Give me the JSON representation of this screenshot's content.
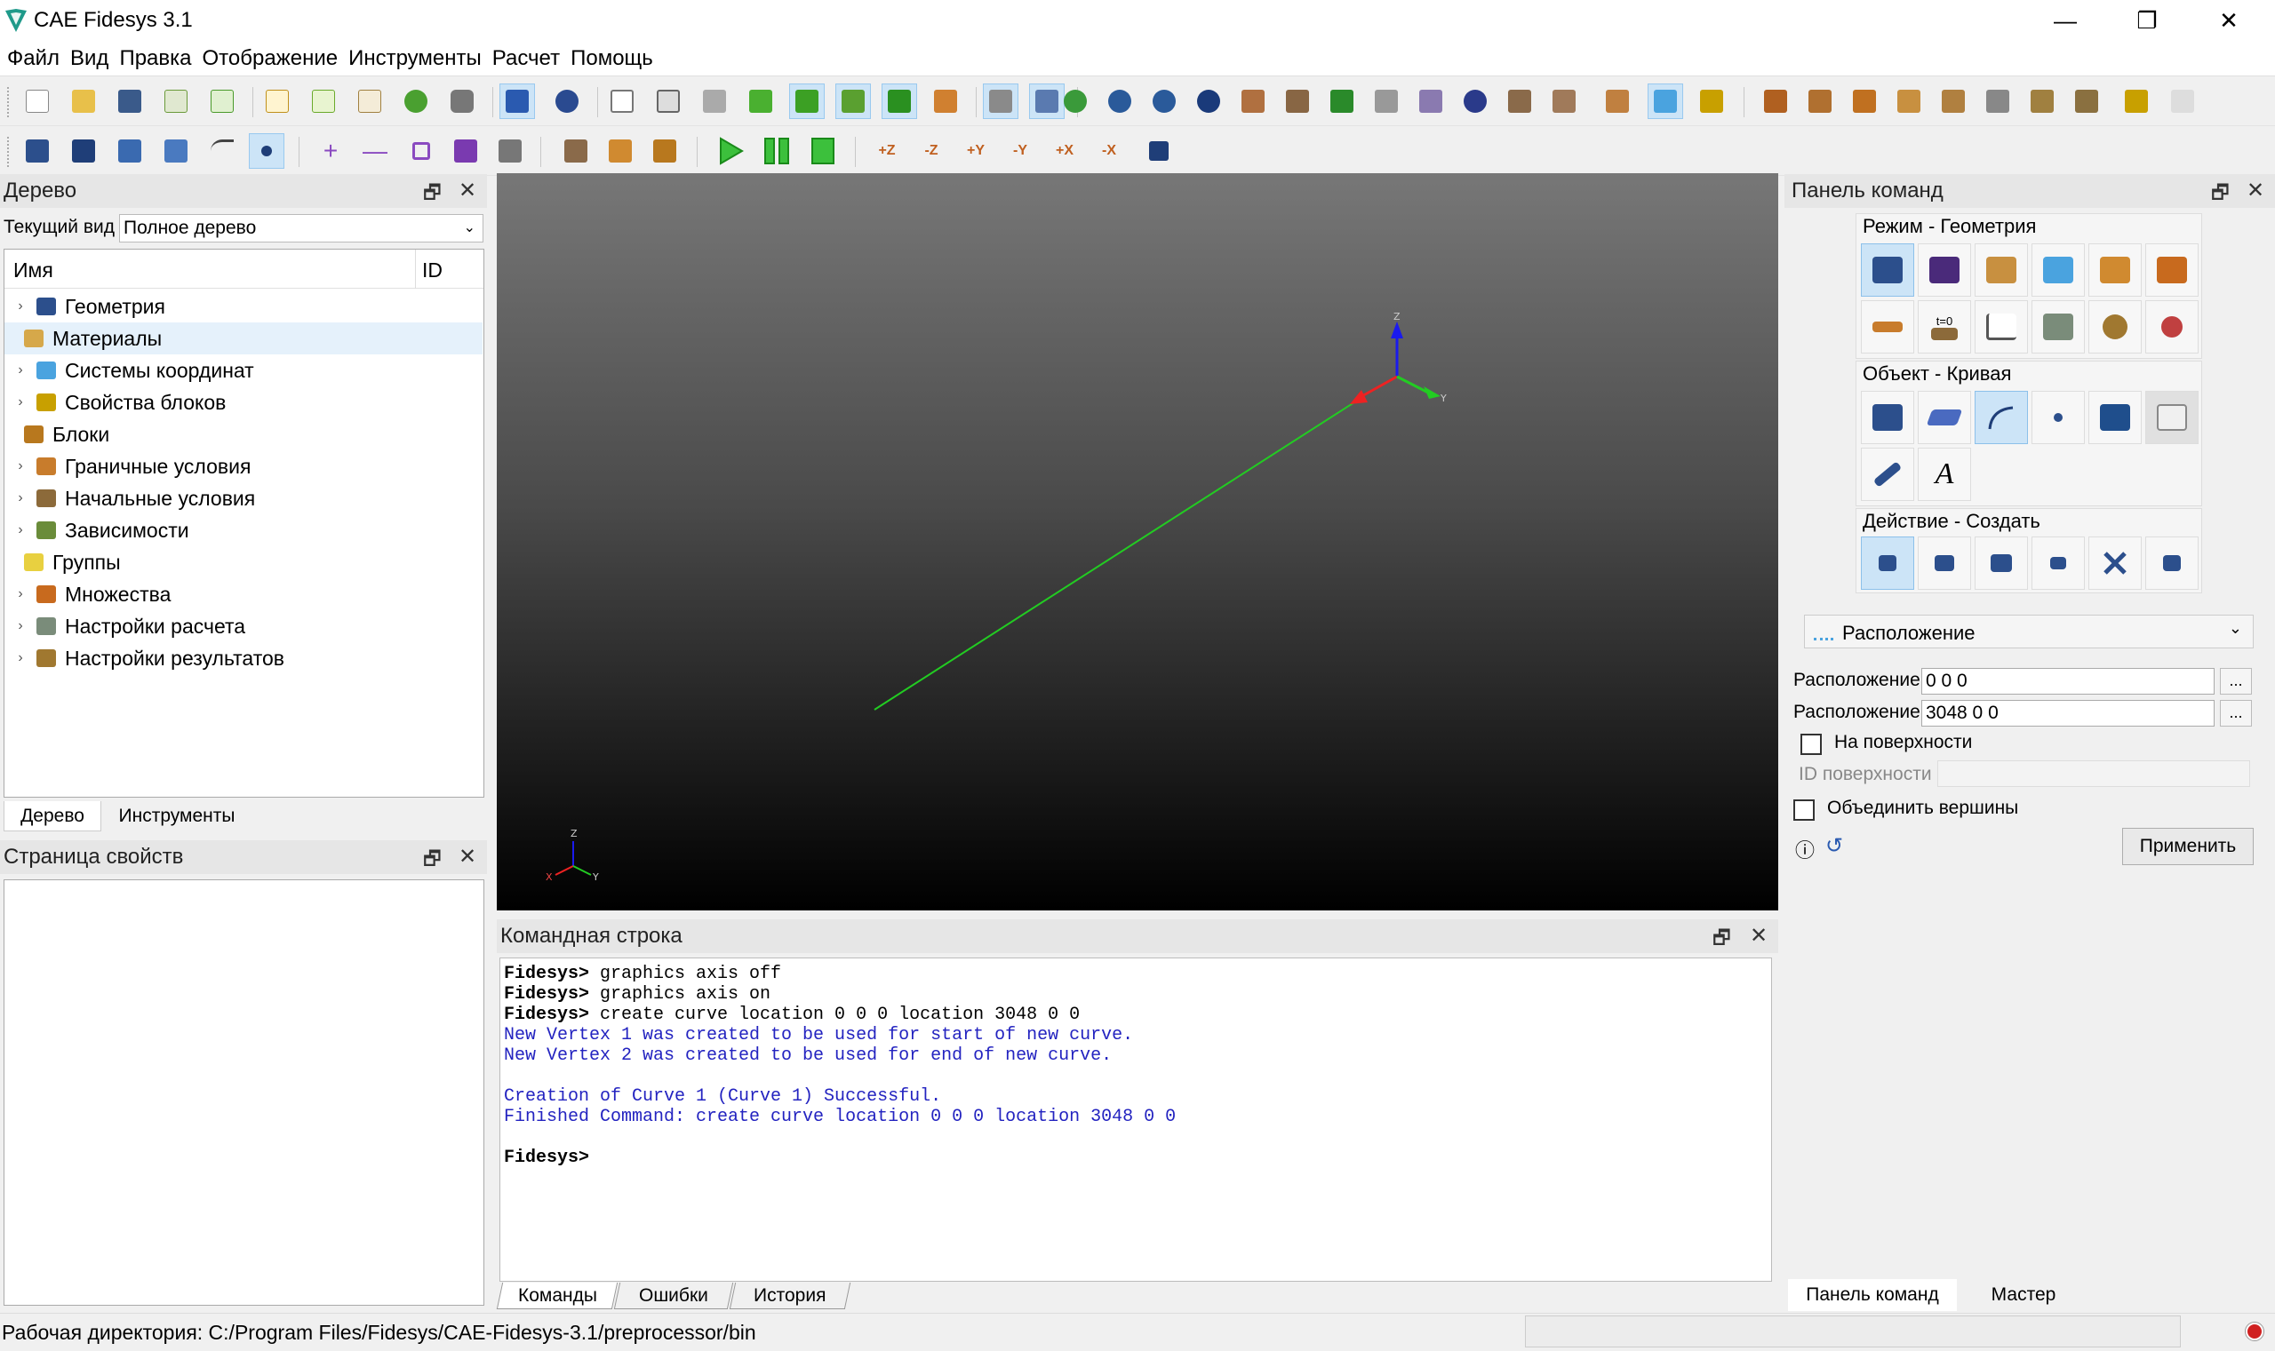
{
  "window": {
    "title": "CAE Fidesys 3.1",
    "minimize": "—",
    "restore": "❐",
    "close": "✕"
  },
  "menu": [
    "Файл",
    "Вид",
    "Правка",
    "Отображение",
    "Инструменты",
    "Расчет",
    "Помощь"
  ],
  "tree_panel": {
    "title": "Дерево",
    "view_label": "Текущий вид",
    "view_value": "Полное дерево",
    "col_name": "Имя",
    "col_id": "ID",
    "items": [
      {
        "label": "Геометрия",
        "expandable": true,
        "color": "#2c4f8c"
      },
      {
        "label": "Материалы",
        "expandable": false,
        "color": "#d6a84a"
      },
      {
        "label": "Системы координат",
        "expandable": true,
        "color": "#4aa3df"
      },
      {
        "label": "Свойства блоков",
        "expandable": true,
        "color": "#c8a000"
      },
      {
        "label": "Блоки",
        "expandable": false,
        "color": "#b8781e"
      },
      {
        "label": "Граничные условия",
        "expandable": true,
        "color": "#c87c2c"
      },
      {
        "label": "Начальные условия",
        "expandable": true,
        "color": "#8c6a3a"
      },
      {
        "label": "Зависимости",
        "expandable": true,
        "color": "#6a8c3a"
      },
      {
        "label": "Группы",
        "expandable": false,
        "color": "#e8d040"
      },
      {
        "label": "Множества",
        "expandable": true,
        "color": "#c86a1e"
      },
      {
        "label": "Настройки расчета",
        "expandable": true,
        "color": "#7a8c7a"
      },
      {
        "label": "Настройки результатов",
        "expandable": true,
        "color": "#a07830"
      }
    ],
    "tabs": [
      "Дерево",
      "Инструменты"
    ]
  },
  "props_panel": {
    "title": "Страница свойств"
  },
  "viewport": {
    "axis_labels": {
      "z": "Z",
      "y": "Y",
      "x": "X"
    }
  },
  "command_panel": {
    "title": "Командная строка",
    "lines": [
      {
        "type": "cmd",
        "prompt": "Fidesys>",
        "text": " graphics axis off"
      },
      {
        "type": "cmd",
        "prompt": "Fidesys>",
        "text": " graphics axis on"
      },
      {
        "type": "cmd",
        "prompt": "Fidesys>",
        "text": " create curve location 0 0 0 location 3048 0 0"
      },
      {
        "type": "out",
        "prompt": "",
        "text": "New Vertex 1 was created to be used for start of new curve."
      },
      {
        "type": "out",
        "prompt": "",
        "text": "New Vertex 2 was created to be used for end of new curve."
      },
      {
        "type": "out",
        "prompt": "",
        "text": " "
      },
      {
        "type": "out",
        "prompt": "",
        "text": "Creation of Curve 1 (Curve 1) Successful."
      },
      {
        "type": "out",
        "prompt": "",
        "text": "Finished Command: create curve location 0 0 0 location 3048 0 0"
      },
      {
        "type": "out",
        "prompt": "",
        "text": " "
      },
      {
        "type": "cmd",
        "prompt": "Fidesys>",
        "text": ""
      }
    ],
    "tabs": [
      "Команды",
      "Ошибки",
      "История"
    ]
  },
  "right_panel": {
    "title": "Панель команд",
    "mode_label": "Режим - Геометрия",
    "object_label": "Объект - Кривая",
    "action_label": "Действие - Создать",
    "t0_label": "t=0",
    "text_icon_label": "A",
    "method_dropdown": "Расположение",
    "location1_label": "Расположение",
    "location1_value": "0 0 0",
    "location2_label": "Расположение",
    "location2_value": "3048 0 0",
    "dots": "...",
    "on_surface_label": "На поверхности",
    "surface_id_label": "ID поверхности",
    "merge_vertices_label": "Объединить вершины",
    "info_glyph": "ⓘ",
    "reset_glyph": "↺",
    "apply_label": "Применить",
    "tabs": [
      "Панель команд",
      "Мастер"
    ]
  },
  "statusbar": {
    "workdir": "Рабочая директория: C:/Program Files/Fidesys/CAE-Fidesys-3.1/preprocessor/bin"
  },
  "toolbar2_axes": [
    "+Z",
    "-Z",
    "+Y",
    "-Y",
    "+X",
    "-X"
  ]
}
